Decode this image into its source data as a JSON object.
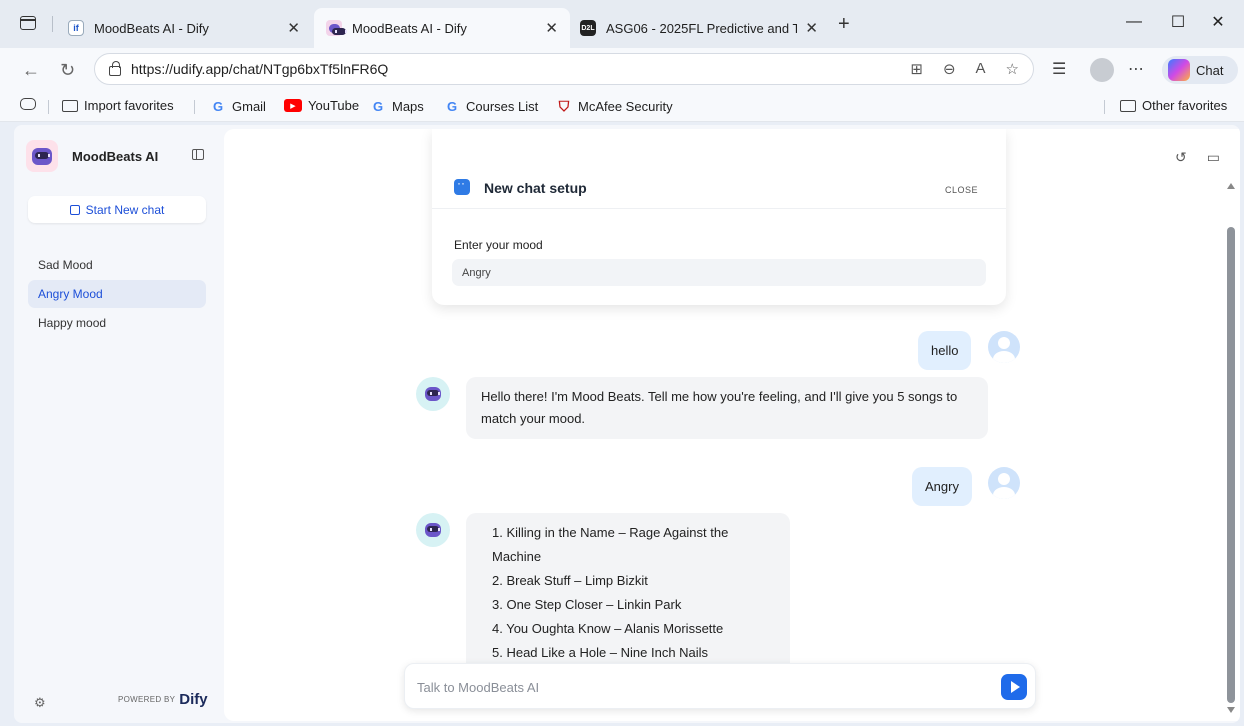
{
  "browser": {
    "tabs": [
      {
        "title": "MoodBeats AI - Dify",
        "favicon": "if"
      },
      {
        "title": "MoodBeats AI - Dify",
        "favicon": ""
      },
      {
        "title": "ASG06 - 2025FL Predictive and Te",
        "favicon": "D2L"
      }
    ],
    "url": "https://udify.app/chat/NTgp6bxTf5lnFR6Q",
    "chat_label": "Chat",
    "favorites": {
      "import": "Import favorites",
      "gmail": "Gmail",
      "youtube": "YouTube",
      "maps": "Maps",
      "courses": "Courses List",
      "mcafee": "McAfee Security",
      "other": "Other favorites"
    }
  },
  "app": {
    "name": "MoodBeats AI",
    "new_chat_label": "Start New chat",
    "conversations": [
      {
        "label": "Sad Mood",
        "active": false
      },
      {
        "label": "Angry Mood",
        "active": true
      },
      {
        "label": "Happy mood",
        "active": false
      }
    ],
    "powered_by": "POWERED BY",
    "powered_logo": "Dify"
  },
  "setup": {
    "title": "New chat setup",
    "close_label": "CLOSE",
    "mood_label": "Enter your mood",
    "mood_value": "Angry"
  },
  "messages": {
    "user_1": "hello",
    "bot_1": "Hello there! I'm Mood Beats. Tell me how you're feeling, and I'll give you 5 songs to match your mood.",
    "user_2": "Angry",
    "songs": [
      "1. Killing in the Name – Rage Against the Machine",
      "2. Break Stuff – Limp Bizkit",
      "3. One Step Closer – Linkin Park",
      "4. You Oughta Know – Alanis Morissette",
      "5. Head Like a Hole – Nine Inch Nails"
    ]
  },
  "composer": {
    "placeholder": "Talk to MoodBeats AI"
  },
  "colors": {
    "accent": "#1d4fd8",
    "send_button": "#1f6bea",
    "user_bubble": "#e1effe",
    "bot_bubble": "#f3f4f6"
  }
}
